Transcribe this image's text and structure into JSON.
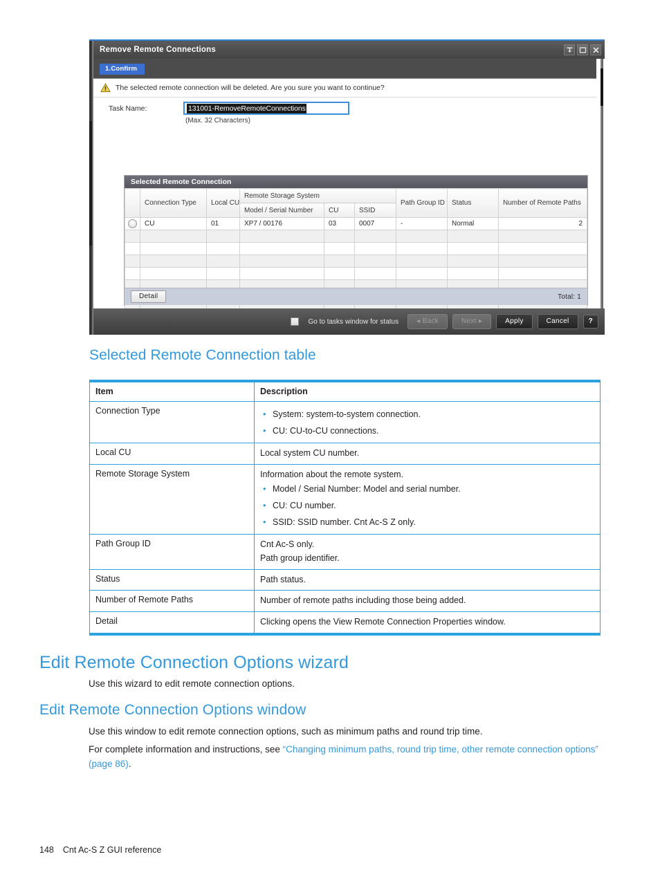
{
  "dialog": {
    "title": "Remove Remote Connections",
    "title_buttons": [
      {
        "name": "pin-icon",
        "glyph": "pin"
      },
      {
        "name": "maximize-icon",
        "glyph": "square"
      },
      {
        "name": "close-icon",
        "glyph": "x"
      }
    ],
    "step_tab": "1.Confirm",
    "warning_text": "The selected remote connection will be deleted. Are you sure you want to continue?",
    "task_name_label": "Task Name:",
    "task_name_value": "131001-RemoveRemoteConnections",
    "task_name_hint": "(Max. 32 Characters)",
    "panel_title": "Selected Remote Connection",
    "grid": {
      "group_headers": {
        "connection_type": "Connection Type",
        "local_cu": "Local CU",
        "remote_storage_system": "Remote Storage System",
        "path_group_id": "Path Group ID",
        "status": "Status",
        "number_of_remote_paths": "Number of Remote Paths"
      },
      "sub_headers": {
        "model_serial": "Model / Serial Number",
        "cu": "CU",
        "ssid": "SSID"
      },
      "rows": [
        {
          "connection_type": "CU",
          "local_cu": "01",
          "model_serial": "XP7 / 00176",
          "cu": "03",
          "ssid": "0007",
          "path_group_id": "-",
          "status": "Normal",
          "remote_paths": "2"
        }
      ],
      "empty_row_count": 8
    },
    "detail_button": "Detail",
    "total_text": "Total:  1",
    "footer": {
      "checkbox_label": "Go to tasks window for status",
      "back": "Back",
      "next": "Next",
      "apply": "Apply",
      "cancel": "Cancel",
      "help": "?"
    },
    "accent_color": "#3a6fd0"
  },
  "doc": {
    "table_heading": "Selected Remote Connection table",
    "table": {
      "headers": [
        "Item",
        "Description"
      ],
      "rows": [
        {
          "item": "Connection Type",
          "intro": "",
          "bullets": [
            "System: system-to-system connection.",
            "CU: CU-to-CU connections."
          ],
          "lines": []
        },
        {
          "item": "Local CU",
          "intro": "",
          "bullets": [],
          "lines": [
            "Local system CU number."
          ]
        },
        {
          "item": "Remote Storage System",
          "intro": "Information about the remote system.",
          "bullets": [
            "Model / Serial Number: Model and serial number.",
            "CU: CU number.",
            "SSID: SSID number. Cnt Ac-S Z only."
          ],
          "lines": []
        },
        {
          "item": "Path Group ID",
          "intro": "",
          "bullets": [],
          "lines": [
            "Cnt Ac-S only.",
            "Path group identifier."
          ]
        },
        {
          "item": "Status",
          "intro": "",
          "bullets": [],
          "lines": [
            "Path status."
          ]
        },
        {
          "item": "Number of Remote Paths",
          "intro": "",
          "bullets": [],
          "lines": [
            "Number of remote paths including those being added."
          ]
        },
        {
          "item": "Detail",
          "intro": "",
          "bullets": [],
          "lines": [
            "Clicking opens the View Remote Connection Properties window."
          ]
        }
      ]
    },
    "wizard_heading": "Edit Remote Connection Options wizard",
    "wizard_para": "Use this wizard to edit remote connection options.",
    "window_heading": "Edit Remote Connection Options window",
    "window_para": "Use this window to edit remote connection options, such as minimum paths and round trip time.",
    "window_para2_prefix": "For complete information and instructions, see ",
    "window_para2_link": "“Changing minimum paths, round trip time, other remote connection options” (page 86)",
    "window_para2_suffix": ".",
    "link_color": "#3399dd"
  },
  "page_footer": {
    "page_number": "148",
    "chapter": "Cnt Ac-S Z GUI reference"
  }
}
